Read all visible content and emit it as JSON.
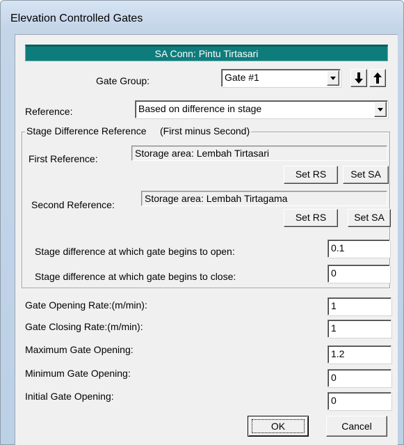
{
  "window": {
    "title": "Elevation Controlled Gates"
  },
  "banner": {
    "text": "SA Conn: Pintu Tirtasari"
  },
  "gate_group": {
    "label": "Gate Group:",
    "value": "Gate #1"
  },
  "reference": {
    "label": "Reference:",
    "value": "Based on difference in stage"
  },
  "stage_group": {
    "title": "Stage Difference Reference     (First minus Second)",
    "first_label": "First Reference:",
    "first_value": "Storage area: Lembah Tirtasari",
    "second_label": "Second Reference:",
    "second_value": "Storage area: Lembah Tirtagama",
    "set_rs": "Set RS",
    "set_sa": "Set SA",
    "open_label": "Stage difference at which gate begins to open:",
    "open_value": "0.1",
    "close_label": "Stage difference at which gate begins to close:",
    "close_value": "0"
  },
  "params": {
    "opening_rate_label": "Gate Opening Rate:(m/min):",
    "opening_rate_value": "1",
    "closing_rate_label": "Gate Closing Rate:(m/min):",
    "closing_rate_value": "1",
    "max_open_label": "Maximum Gate Opening:",
    "max_open_value": "1.2",
    "min_open_label": "Minimum Gate Opening:",
    "min_open_value": "0",
    "initial_open_label": "Initial Gate Opening:",
    "initial_open_value": "0"
  },
  "buttons": {
    "ok": "OK",
    "cancel": "Cancel"
  },
  "icons": {
    "move_down": "arrow-down-icon",
    "move_up": "arrow-up-icon",
    "dropdown": "chevron-down-icon"
  },
  "colors": {
    "banner": "#0f7c7c"
  }
}
